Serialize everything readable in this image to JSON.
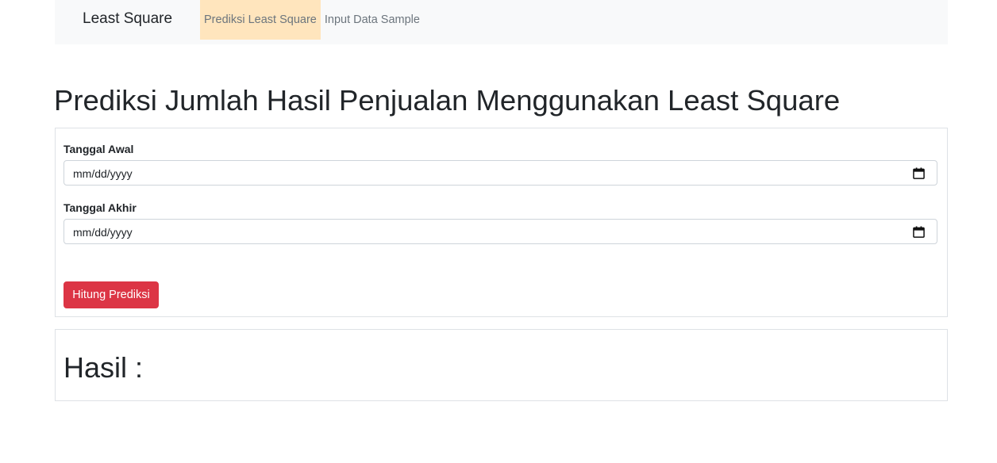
{
  "navbar": {
    "brand": "Least Square",
    "links": [
      {
        "label": "Prediksi Least Square",
        "active": true,
        "highlight_color": "#ffe5bd"
      },
      {
        "label": "Input Data Sample",
        "active": false
      }
    ]
  },
  "page": {
    "title": "Prediksi Jumlah Hasil Penjualan Menggunakan Least Square"
  },
  "form": {
    "start_date": {
      "label": "Tanggal Awal",
      "placeholder": "mm/dd/yyyy",
      "value": ""
    },
    "end_date": {
      "label": "Tanggal Akhir",
      "placeholder": "mm/dd/yyyy",
      "value": ""
    },
    "submit_label": "Hitung Prediksi",
    "submit_color": "#dc3545"
  },
  "result": {
    "heading": "Hasil :"
  }
}
